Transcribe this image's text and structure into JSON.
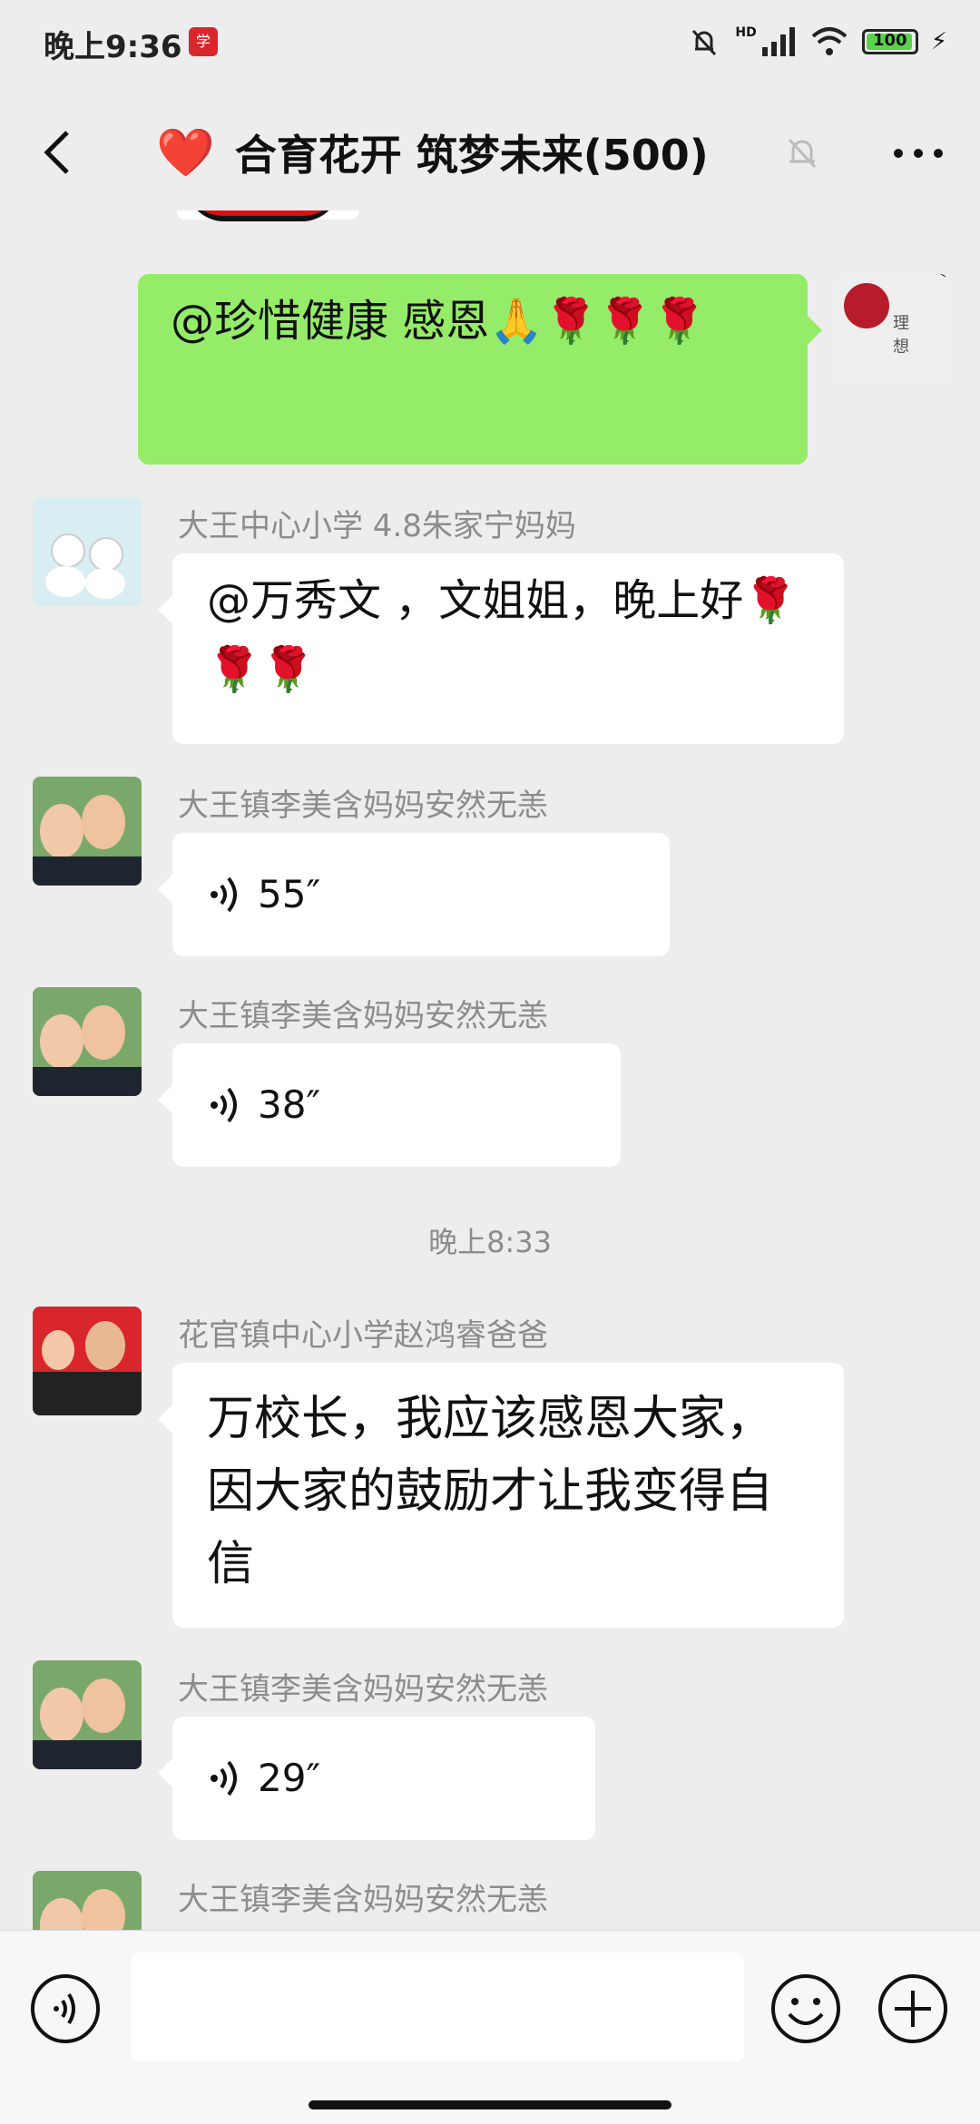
{
  "status_bar": {
    "time": "晚上9:36",
    "battery": "100",
    "network": "HD"
  },
  "nav": {
    "title": "合育花开 筑梦未来(500)",
    "heart": "❤️"
  },
  "messages": [
    {
      "type": "text",
      "side": "right",
      "text": "@珍惜健康  感恩🙏🌹🌹🌹"
    },
    {
      "type": "text",
      "side": "left",
      "sender": "大王中心小学 4.8朱家宁妈妈",
      "text": "@万秀文 ，文姐姐，晚上好🌹🌹🌹"
    },
    {
      "type": "voice",
      "side": "left",
      "sender": "大王镇李美含妈妈安然无恙",
      "duration": "55″"
    },
    {
      "type": "voice",
      "side": "left",
      "sender": "大王镇李美含妈妈安然无恙",
      "duration": "38″"
    },
    {
      "type": "time",
      "text": "晚上8:33"
    },
    {
      "type": "text",
      "side": "left",
      "sender": "花官镇中心小学赵鸿睿爸爸",
      "text": "万校长，我应该感恩大家，因大家的鼓励才让我变得自信"
    },
    {
      "type": "voice",
      "side": "left",
      "sender": "大王镇李美含妈妈安然无恙",
      "duration": "29″"
    },
    {
      "type": "voice",
      "side": "left",
      "sender": "大王镇李美含妈妈安然无恙",
      "duration": ""
    }
  ],
  "colors": {
    "bg": "#ededed",
    "self_bubble": "#95ec69",
    "other_bubble": "#ffffff",
    "meta_text": "#8c8c8c"
  },
  "icons": [
    "back-icon",
    "mute-bell-icon",
    "more-icon",
    "voice-icon",
    "emoji-icon",
    "plus-icon"
  ]
}
